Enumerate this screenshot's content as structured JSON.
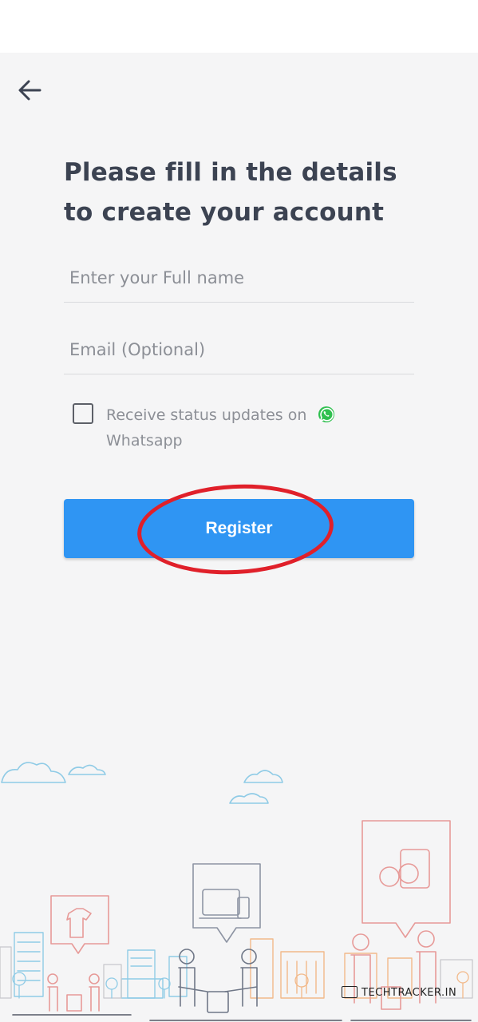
{
  "header": {
    "back_icon": "arrow-left-icon"
  },
  "form": {
    "title": "Please fill in the details to create your account",
    "full_name_placeholder": "Enter your Full name",
    "email_placeholder": "Email (Optional)",
    "whatsapp_checkbox_checked": false,
    "whatsapp_label": "Receive status updates on",
    "whatsapp_label_cont": "Whatsapp",
    "whatsapp_icon": "whatsapp-icon",
    "register_label": "Register"
  },
  "watermark": {
    "text": "TECHTRACKER.IN"
  },
  "colors": {
    "accent": "#2f95f3",
    "annotation": "#e0202a",
    "text": "#3c4352",
    "hint": "#8c8f96",
    "background": "#f5f5f6"
  }
}
